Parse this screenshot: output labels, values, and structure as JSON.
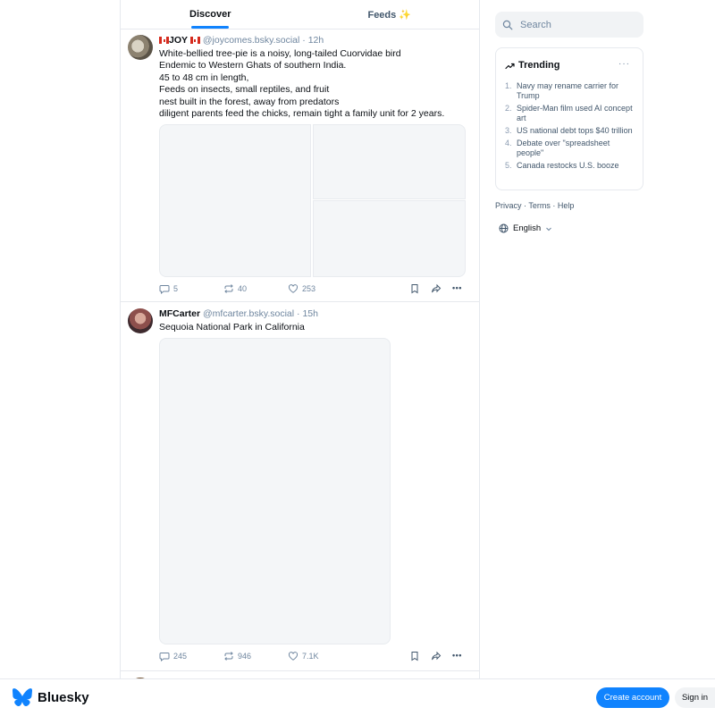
{
  "tabs": {
    "discover": "Discover",
    "feeds": "Feeds ✨"
  },
  "posts": [
    {
      "display_name": "JOY",
      "handle": "@joycomes.bsky.social",
      "time": "12h",
      "lines": [
        "White-bellied tree-pie  is a noisy, long-tailed Cuorvidae bird",
        "Endemic to Western Ghats of southern India.",
        "45 to 48 cm in length,",
        "Feeds on insects, small reptiles, and fruit",
        "nest built in the forest, away from predators",
        "diligent parents feed the chicks, remain tight a family unit for 2 years."
      ],
      "replies": "5",
      "reposts": "40",
      "likes": "253"
    },
    {
      "display_name": "MFCarter",
      "handle": "@mfcarter.bsky.social",
      "time": "15h",
      "lines": [
        "Sequoia National Park in California"
      ],
      "replies": "245",
      "reposts": "946",
      "likes": "7.1K"
    }
  ],
  "search": {
    "placeholder": "Search"
  },
  "trending": {
    "title": "Trending",
    "more": "···",
    "items": [
      {
        "num": "1.",
        "label": "Navy may rename carrier for Trump"
      },
      {
        "num": "2.",
        "label": "Spider-Man film used AI concept art"
      },
      {
        "num": "3.",
        "label": "US national debt tops $40 trillion"
      },
      {
        "num": "4.",
        "label": "Debate over \"spreadsheet people\""
      },
      {
        "num": "5.",
        "label": "Canada restocks U.S. booze"
      }
    ]
  },
  "footer": {
    "privacy": "Privacy",
    "terms": "Terms",
    "help": "Help",
    "sep": "·"
  },
  "language": "English",
  "brand": "Bluesky",
  "bottom": {
    "create": "Create account",
    "signin": "Sign in"
  },
  "colors": {
    "accent": "#1083fe",
    "muted": "#6f869f",
    "border": "#e6e9ee"
  }
}
